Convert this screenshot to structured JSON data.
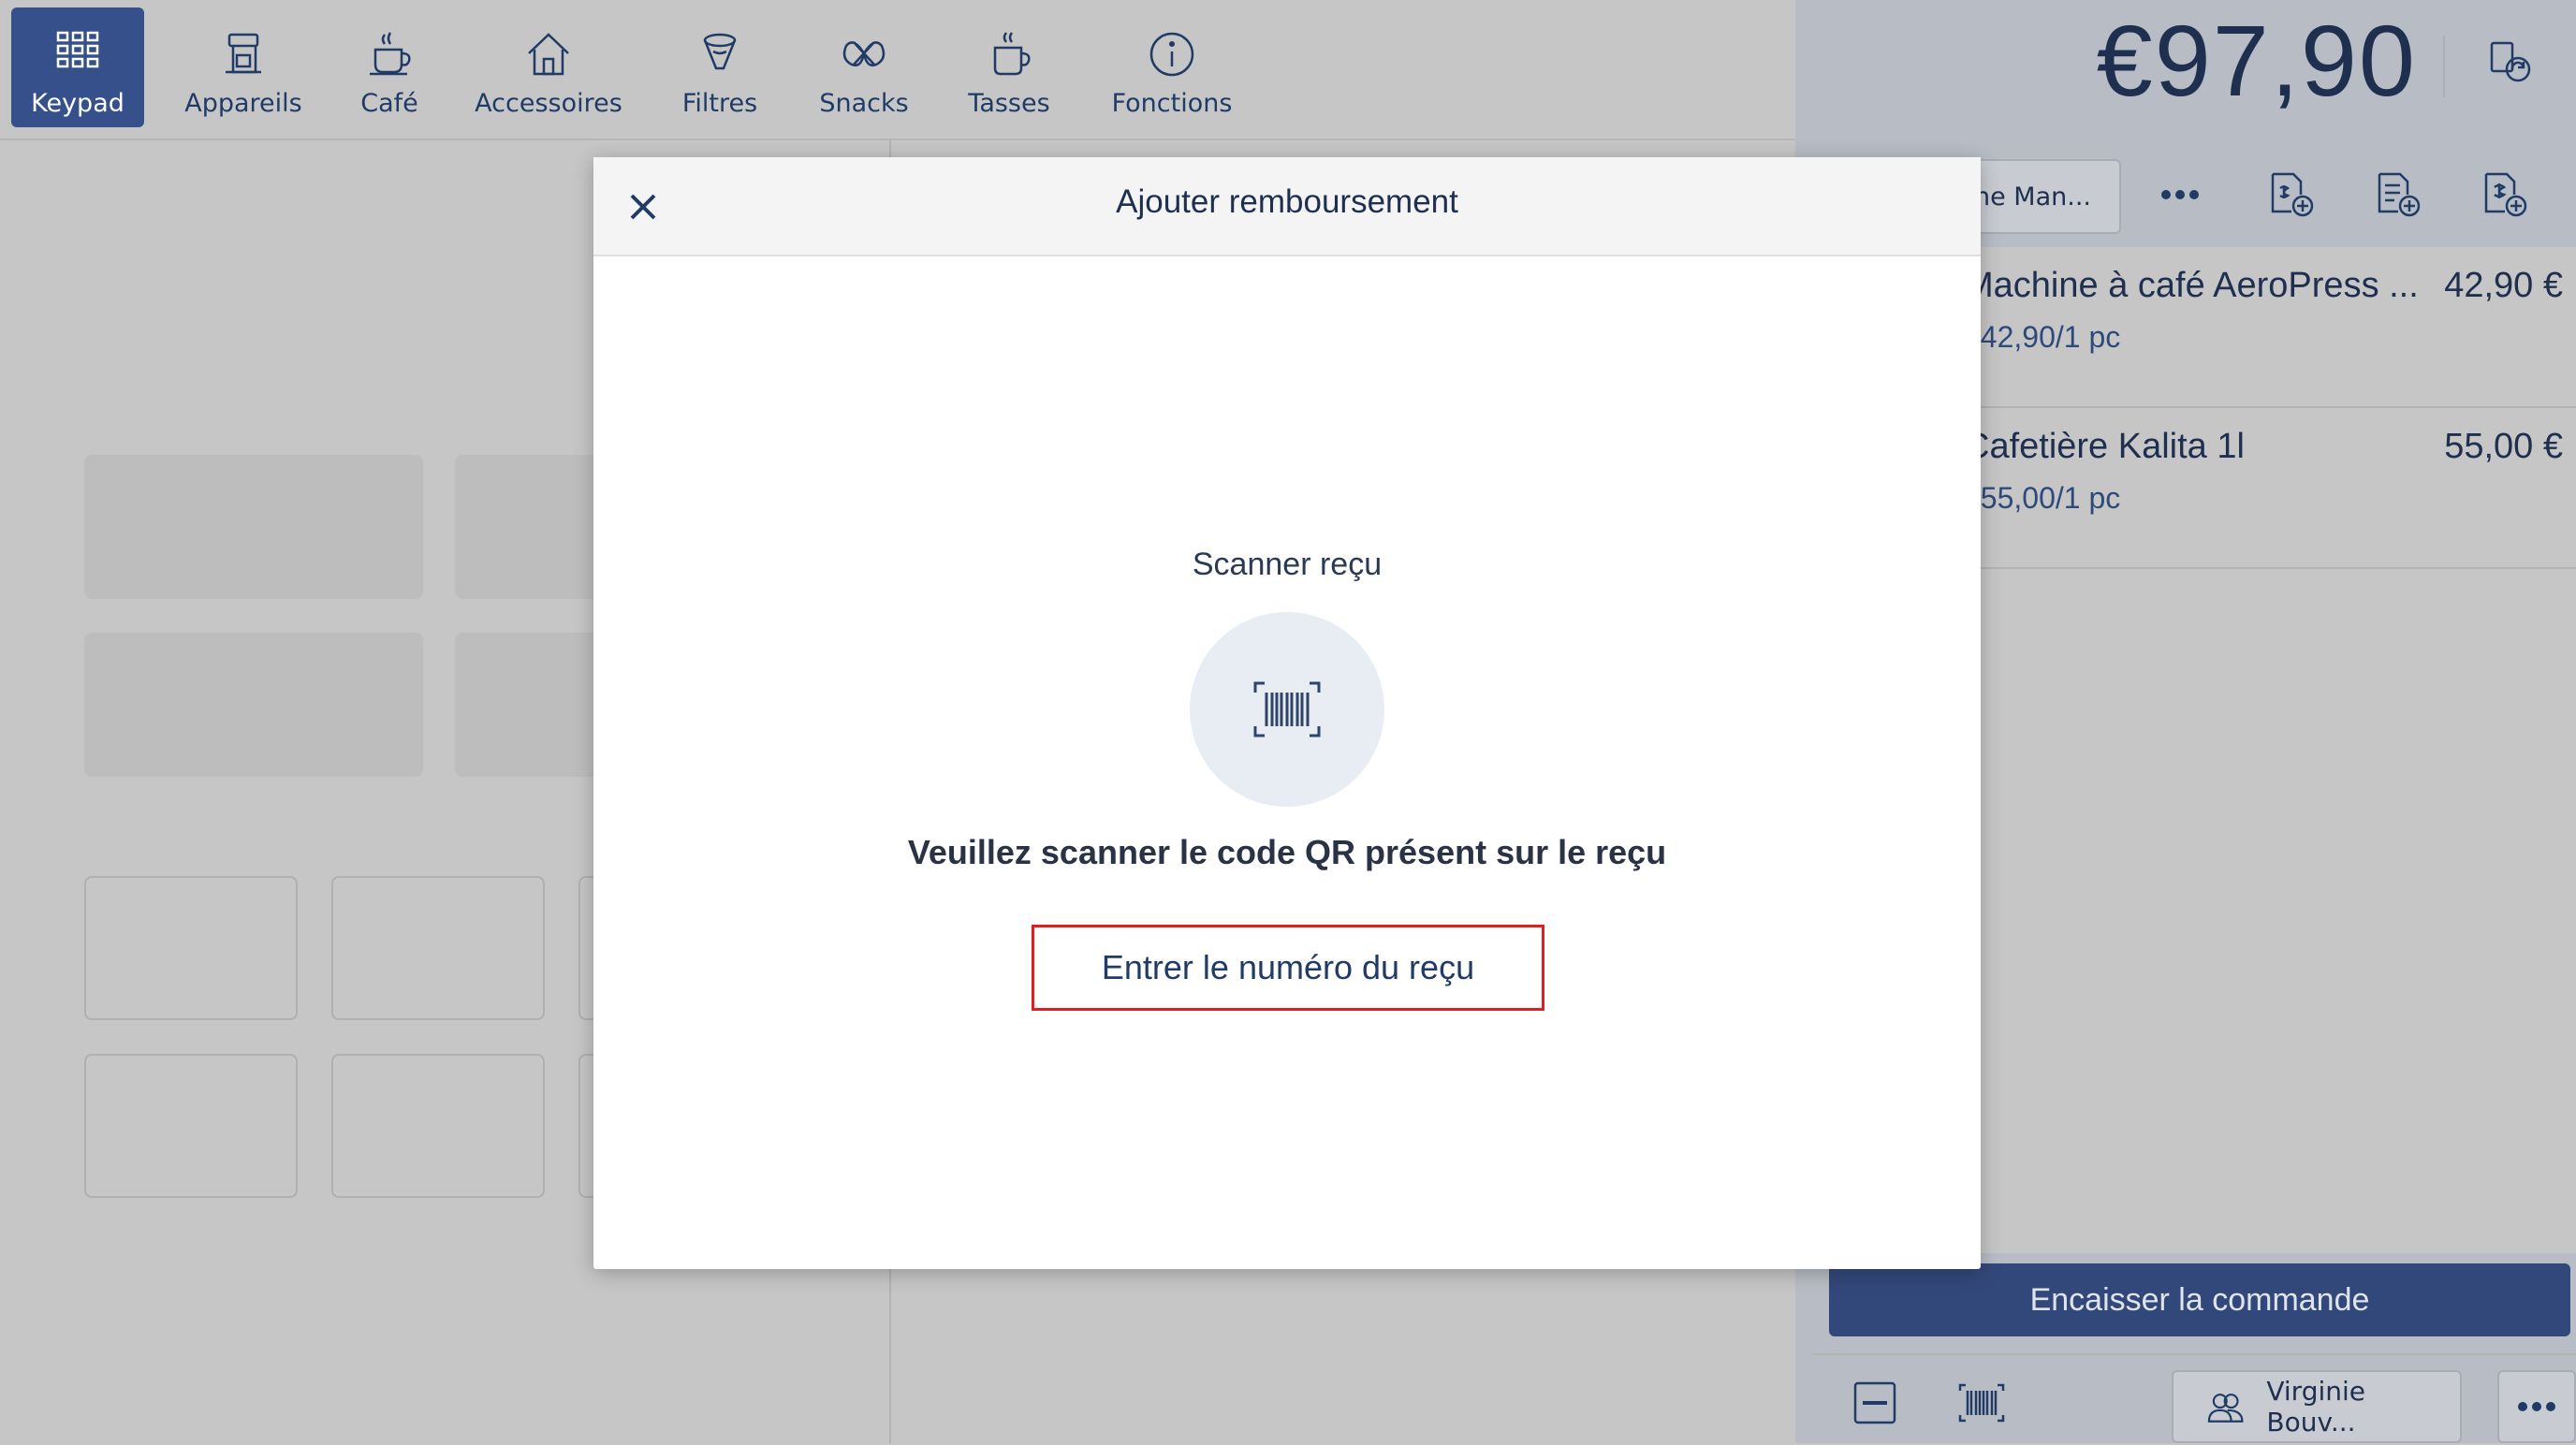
{
  "nav": {
    "items": [
      {
        "label": "Keypad",
        "icon": "keypad-icon",
        "active": true
      },
      {
        "label": "Appareils",
        "icon": "appliance-icon"
      },
      {
        "label": "Café",
        "icon": "coffee-cup-icon"
      },
      {
        "label": "Accessoires",
        "icon": "house-icon"
      },
      {
        "label": "Filtres",
        "icon": "filter-icon"
      },
      {
        "label": "Snacks",
        "icon": "pretzel-icon"
      },
      {
        "label": "Tasses",
        "icon": "mug-icon"
      },
      {
        "label": "Fonctions",
        "icon": "info-icon"
      }
    ]
  },
  "order": {
    "total": "€97,90",
    "seller_label": "ne Man...",
    "lines": [
      {
        "name": "Machine à café AeroPress ...",
        "price": "42,90 €",
        "unit": "€42,90/1 pc"
      },
      {
        "name": "Cafetière Kalita 1l",
        "price": "55,00 €",
        "unit": "€55,00/1 pc"
      }
    ],
    "checkout_label": "Encaisser la commande",
    "customer_label": "Virginie Bouv..."
  },
  "modal": {
    "title": "Ajouter remboursement",
    "scan_label": "Scanner reçu",
    "instruction": "Veuillez scanner le code QR présent sur le reçu",
    "enter_button": "Entrer le numéro du reçu"
  },
  "colors": {
    "accent": "#35508a",
    "checkout": "#33487a",
    "highlight": "#e02020"
  }
}
